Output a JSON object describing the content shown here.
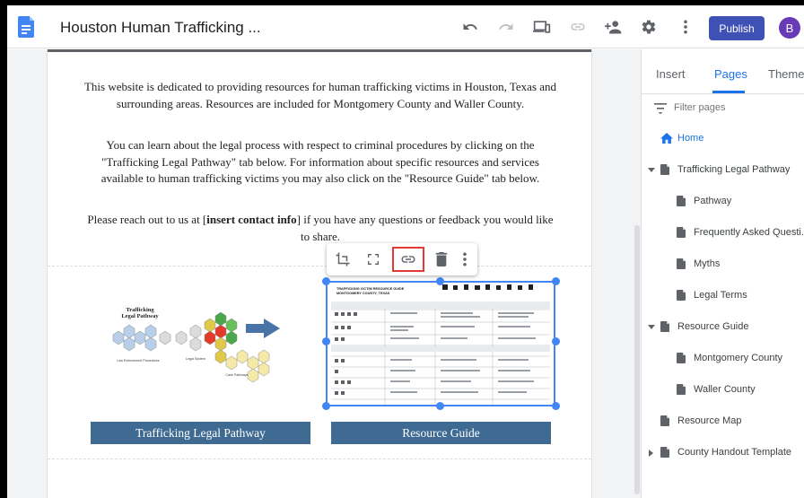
{
  "header": {
    "site_title": "Houston Human Trafficking ...",
    "publish_label": "Publish",
    "avatar_initial": "B"
  },
  "content": {
    "para1": "This website is dedicated to providing resources for human trafficking victims in Houston, Texas and surrounding areas. Resources are included for Montgomery County and Waller County.",
    "para2": "You can learn about the legal process with respect to criminal procedures by clicking on the \"Trafficking Legal Pathway\" tab below. For information about specific resources and services available to human trafficking victims you may also click on the \"Resource Guide\" tab below.",
    "para3_before": "Please reach out to us at [",
    "para3_bold": "insert contact info",
    "para3_after": "] if you have any questions or feedback you would like to share.",
    "button_pathway": "Trafficking Legal Pathway",
    "button_guide": "Resource Guide"
  },
  "pathway_image": {
    "title_line1": "Trafficking",
    "title_line2": "Legal Pathway",
    "label_left": "Law Enforcement Procedures",
    "label_mid": "Legal System",
    "label_right": "Case Pathways"
  },
  "guide_image": {
    "title_line1": "TRAFFICKING VICTIM RESOURCE GUIDE",
    "title_line2": "MONTGOMERY COUNTY, TEXAS"
  },
  "sidebar": {
    "tabs": [
      "Insert",
      "Pages",
      "Themes"
    ],
    "filter_placeholder": "Filter pages",
    "pages": [
      {
        "label": "Home",
        "level": 0,
        "icon": "home-icon",
        "caret": ""
      },
      {
        "label": "Trafficking Legal Pathway",
        "level": 0,
        "icon": "page-icon",
        "caret": "down"
      },
      {
        "label": "Pathway",
        "level": 1,
        "icon": "page-icon",
        "caret": ""
      },
      {
        "label": "Frequently Asked Questi...",
        "level": 1,
        "icon": "page-icon",
        "caret": ""
      },
      {
        "label": "Myths",
        "level": 1,
        "icon": "page-icon",
        "caret": ""
      },
      {
        "label": "Legal Terms",
        "level": 1,
        "icon": "page-icon",
        "caret": ""
      },
      {
        "label": "Resource Guide",
        "level": 0,
        "icon": "page-icon",
        "caret": "down"
      },
      {
        "label": "Montgomery County",
        "level": 1,
        "icon": "page-icon",
        "caret": ""
      },
      {
        "label": "Waller County",
        "level": 1,
        "icon": "page-icon",
        "caret": ""
      },
      {
        "label": "Resource Map",
        "level": 0,
        "icon": "page-icon",
        "caret": ""
      },
      {
        "label": "County Handout Template",
        "level": 0,
        "icon": "page-icon",
        "caret": "right"
      }
    ]
  },
  "colors": {
    "accent": "#1a73e8",
    "publish": "#3f51b5",
    "link_button": "#3f6b93",
    "selection": "#4285f4",
    "highlight_box": "#e53935"
  }
}
